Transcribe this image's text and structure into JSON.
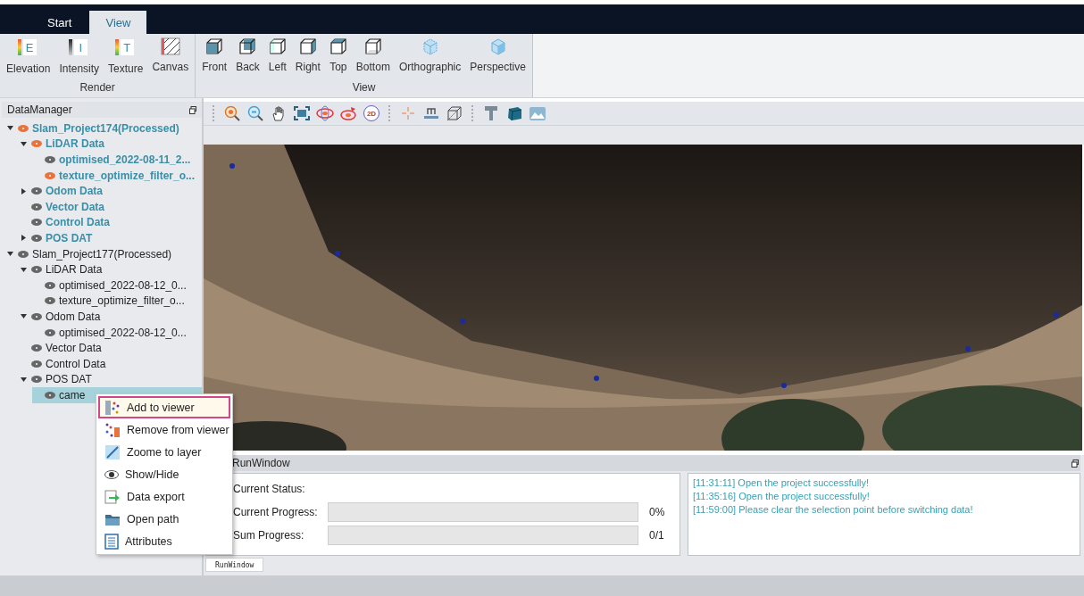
{
  "top_tabs": [
    {
      "label": "Start",
      "selected": false
    },
    {
      "label": "View",
      "selected": true
    }
  ],
  "ribbon": {
    "groups": [
      {
        "label": "Render",
        "items": [
          {
            "label": "Elevation",
            "kind": "letter",
            "glyph": "E"
          },
          {
            "label": "Intensity",
            "kind": "letter",
            "glyph": "I"
          },
          {
            "label": "Texture",
            "kind": "letter",
            "glyph": "T"
          },
          {
            "label": "Canvas",
            "kind": "hatch"
          }
        ]
      },
      {
        "label": "View",
        "items": [
          {
            "label": "Front",
            "kind": "cube"
          },
          {
            "label": "Back",
            "kind": "cube"
          },
          {
            "label": "Left",
            "kind": "cube"
          },
          {
            "label": "Right",
            "kind": "cube"
          },
          {
            "label": "Top",
            "kind": "cube"
          },
          {
            "label": "Bottom",
            "kind": "cube"
          },
          {
            "label": "Orthographic",
            "kind": "cube"
          },
          {
            "label": "Perspective",
            "kind": "cube"
          }
        ]
      }
    ]
  },
  "data_manager": {
    "title": "DataManager",
    "tree": [
      {
        "label": "Slam_Project174(Processed)",
        "active": true,
        "expanded": true,
        "selected": false,
        "color": "#e8743b",
        "children": [
          {
            "label": "LiDAR Data",
            "expanded": true,
            "selected": false,
            "color": "#e8743b",
            "children": [
              {
                "label": "optimised_2022-08-11_2...",
                "selected": false,
                "color": "#666666"
              },
              {
                "label": "texture_optimize_filter_o...",
                "selected": false,
                "color": "#e8743b"
              }
            ]
          },
          {
            "label": "Odom Data",
            "expanded": false,
            "selected": false,
            "color": "#666666"
          },
          {
            "label": "Vector Data",
            "selected": false,
            "color": "#666666"
          },
          {
            "label": "Control Data",
            "selected": false,
            "color": "#666666"
          },
          {
            "label": "POS DAT",
            "expanded": false,
            "selected": false,
            "color": "#666666"
          }
        ]
      },
      {
        "label": "Slam_Project177(Processed)",
        "active": false,
        "expanded": true,
        "selected": false,
        "color": "#666666",
        "children": [
          {
            "label": "LiDAR Data",
            "expanded": true,
            "selected": false,
            "color": "#666666",
            "children": [
              {
                "label": "optimised_2022-08-12_0...",
                "selected": false,
                "color": "#666666"
              },
              {
                "label": "texture_optimize_filter_o...",
                "selected": false,
                "color": "#666666"
              }
            ]
          },
          {
            "label": "Odom Data",
            "expanded": true,
            "selected": false,
            "color": "#666666",
            "children": [
              {
                "label": "optimised_2022-08-12_0...",
                "selected": false,
                "color": "#666666"
              }
            ]
          },
          {
            "label": "Vector Data",
            "selected": false,
            "color": "#666666"
          },
          {
            "label": "Control Data",
            "selected": false,
            "color": "#666666"
          },
          {
            "label": "POS DAT",
            "expanded": true,
            "selected": false,
            "color": "#666666",
            "children": [
              {
                "label": "came",
                "selected": true,
                "color": "#666666"
              }
            ]
          }
        ]
      }
    ]
  },
  "toolbar": {
    "mode_label": "2D"
  },
  "run_window": {
    "title": "RunWindow",
    "status_label": "Current Status:",
    "progress": [
      {
        "label": "Current Progress:",
        "level": 0,
        "reading": "0%"
      },
      {
        "label": "Sum Progress:",
        "level": 0,
        "reading": "0/1"
      }
    ],
    "log": [
      "[11:31:11] Open the project successfully!",
      "[11:35:16] Open the project successfully!",
      "[11:59:00] Please clear the selection point before switching data!"
    ],
    "tab": {
      "label": "RunWindow",
      "selected": true
    }
  },
  "context_menu": {
    "items": [
      {
        "label": "Add to viewer",
        "selected": true
      },
      {
        "label": "Remove from viewer",
        "selected": false
      },
      {
        "label": "Zoome to layer",
        "selected": false
      },
      {
        "label": "Show/Hide",
        "selected": false
      },
      {
        "label": "Data export",
        "selected": false
      },
      {
        "label": "Open path",
        "selected": false
      },
      {
        "label": "Attributes",
        "selected": false
      }
    ]
  }
}
